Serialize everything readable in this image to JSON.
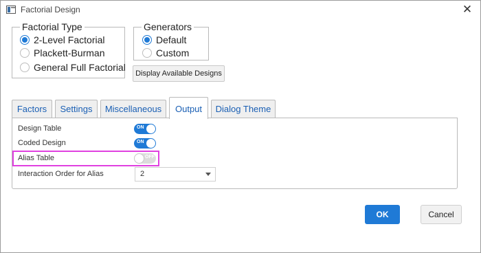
{
  "window": {
    "title": "Factorial Design",
    "close_glyph": "✕"
  },
  "factorial_type": {
    "legend": "Factorial Type",
    "options": [
      {
        "label": "2-Level Factorial",
        "checked": true
      },
      {
        "label": "Plackett-Burman",
        "checked": false
      },
      {
        "label": "General Full Factorial",
        "checked": false
      }
    ]
  },
  "generators": {
    "legend": "Generators",
    "options": [
      {
        "label": "Default",
        "checked": true
      },
      {
        "label": "Custom",
        "checked": false
      }
    ]
  },
  "display_designs_label": "Display Available Designs",
  "tabs": [
    {
      "label": "Factors",
      "active": false
    },
    {
      "label": "Settings",
      "active": false
    },
    {
      "label": "Miscellaneous",
      "active": false
    },
    {
      "label": "Output",
      "active": true
    },
    {
      "label": "Dialog Theme",
      "active": false
    }
  ],
  "output": {
    "design_table": {
      "label": "Design Table",
      "state": "ON"
    },
    "coded_design": {
      "label": "Coded Design",
      "state": "ON"
    },
    "alias_table": {
      "label": "Alias Table",
      "state": "OFF"
    },
    "interaction_order": {
      "label": "Interaction Order for Alias",
      "value": "2"
    }
  },
  "buttons": {
    "ok": "OK",
    "cancel": "Cancel"
  },
  "colors": {
    "accent": "#1f7ad6",
    "highlight": "#e040e0",
    "toggle_off": "#dcdcdc"
  }
}
